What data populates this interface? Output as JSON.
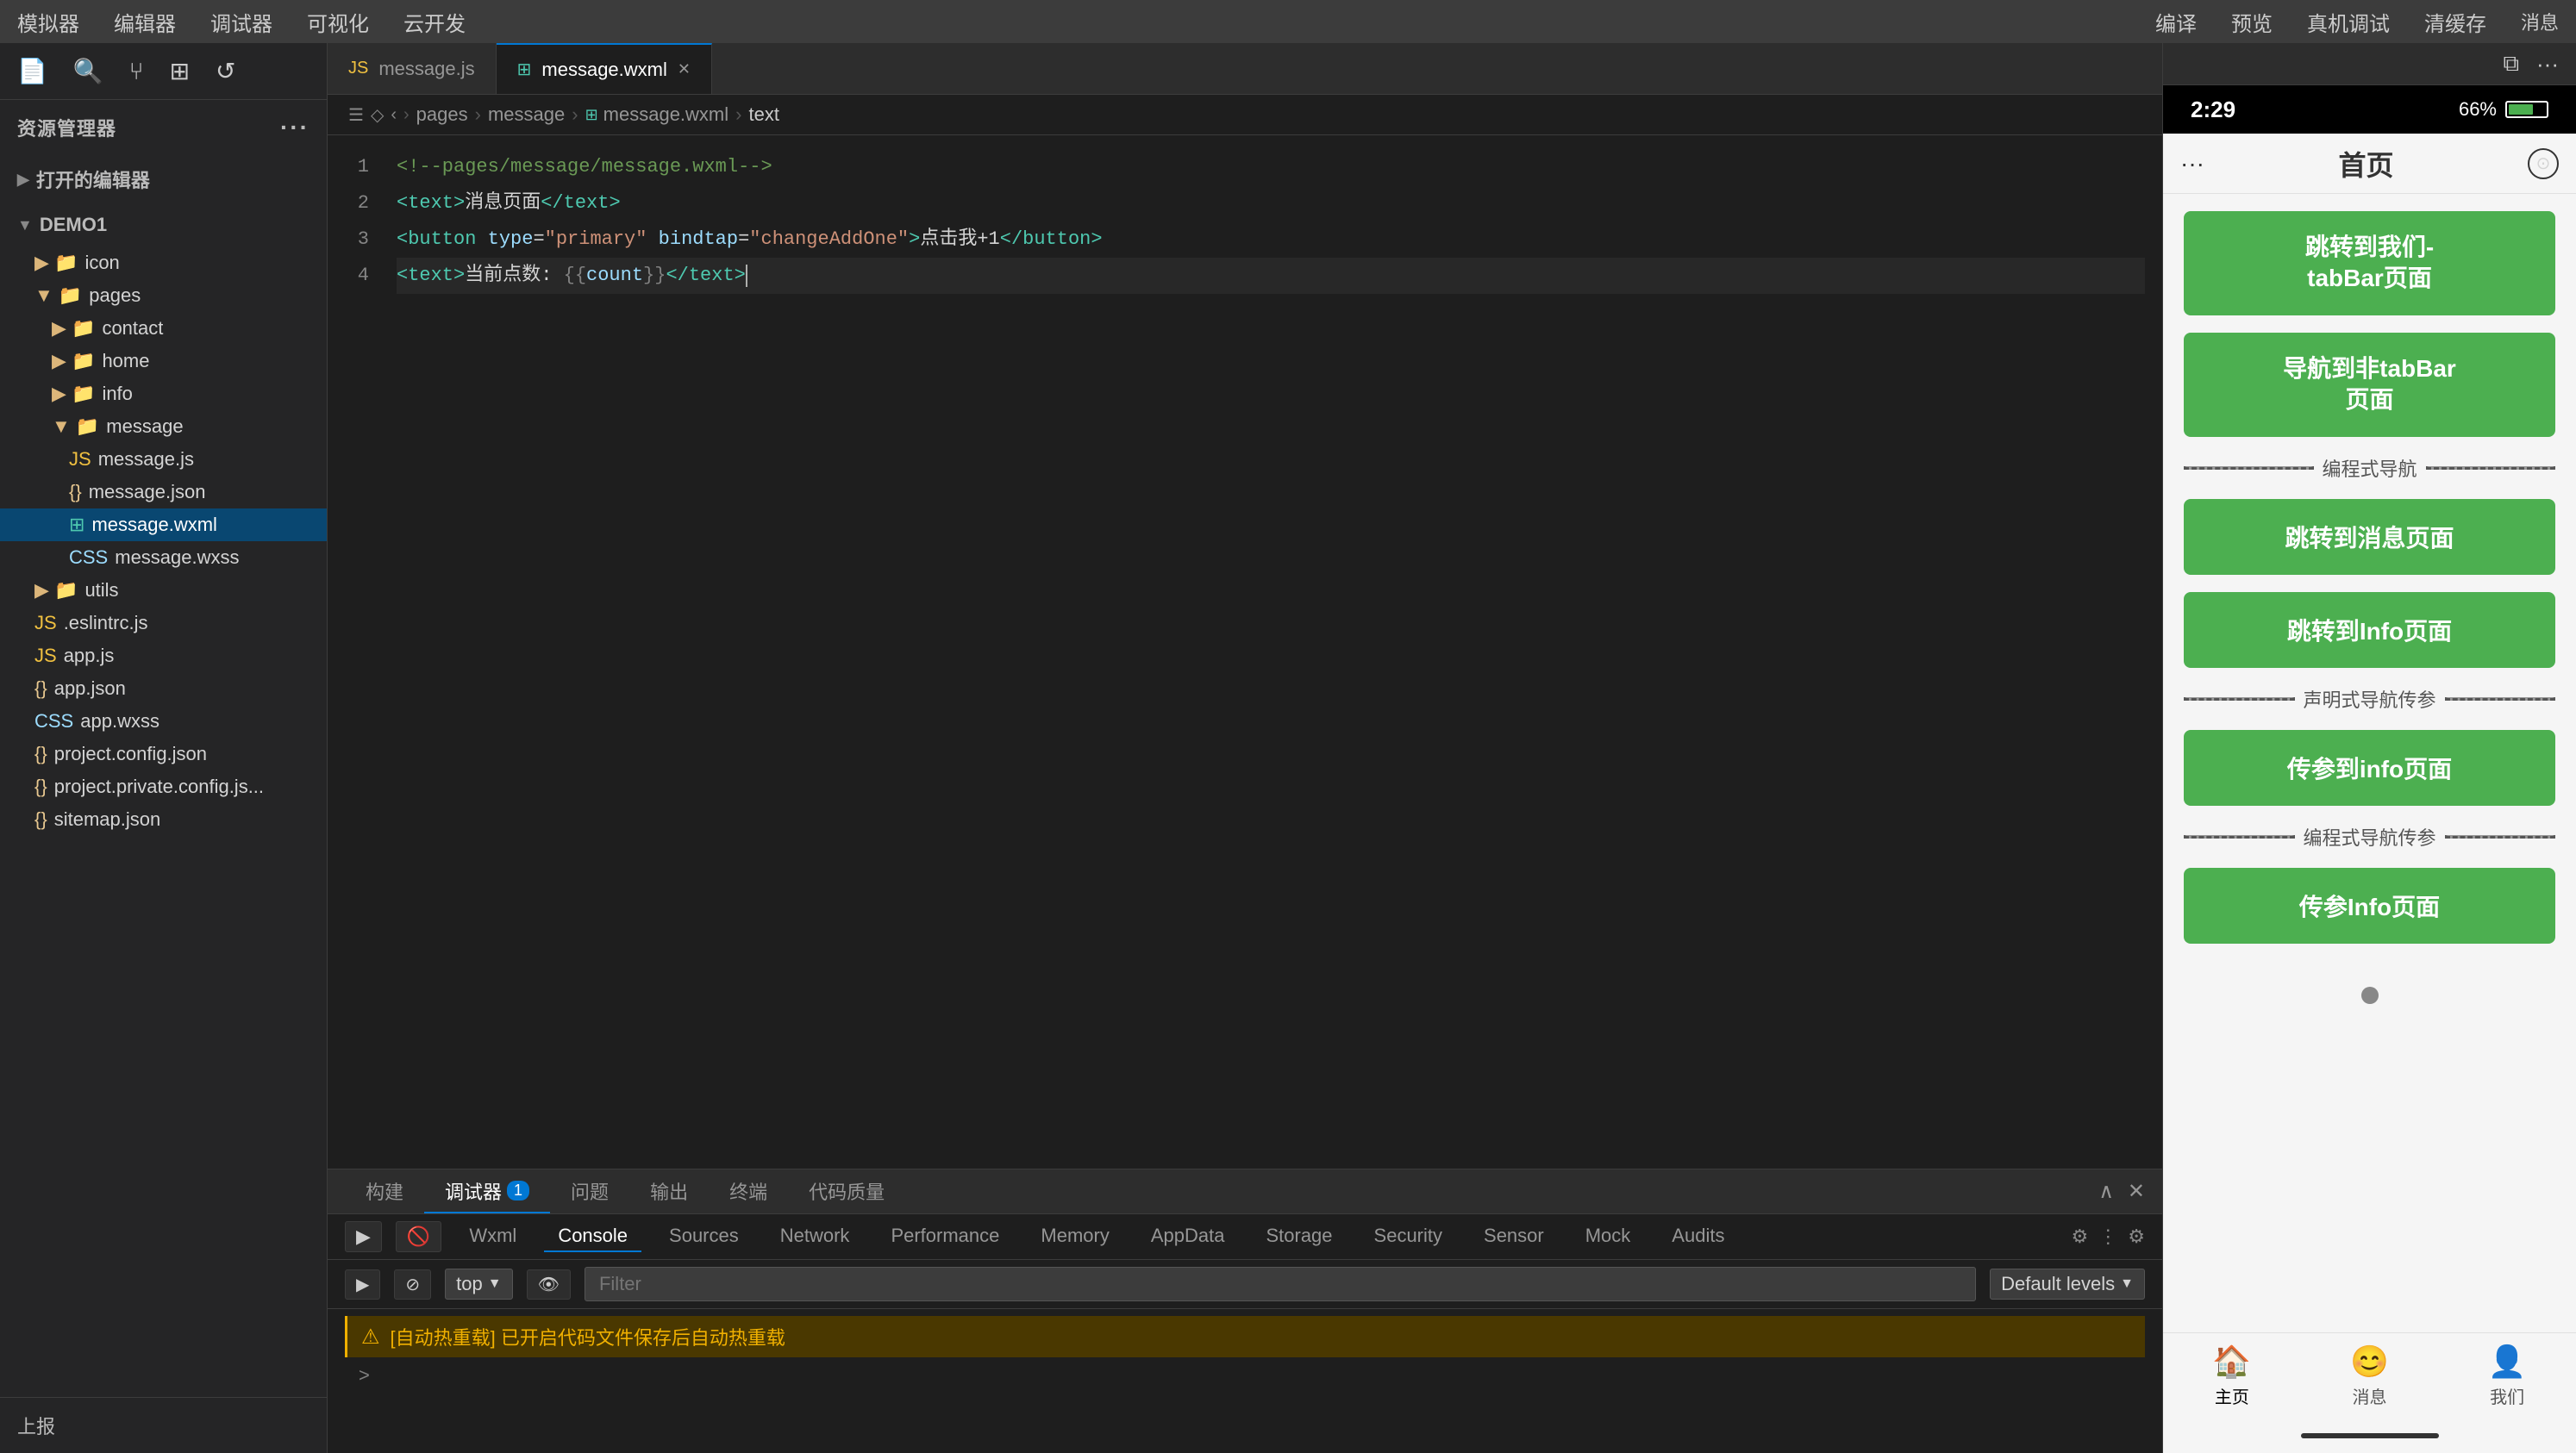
{
  "topMenu": {
    "items": [
      "模拟器",
      "编辑器",
      "调试器",
      "可视化",
      "云开发",
      "编译",
      "预览",
      "真机调试",
      "清缓存"
    ]
  },
  "sidebar": {
    "header": "资源管理器",
    "headerMore": "···",
    "openEditors": "打开的编辑器",
    "demo1": "DEMO1",
    "tree": [
      {
        "label": "icon",
        "type": "folder",
        "indent": 1
      },
      {
        "label": "pages",
        "type": "folder",
        "indent": 1
      },
      {
        "label": "contact",
        "type": "folder",
        "indent": 2
      },
      {
        "label": "home",
        "type": "folder",
        "indent": 2
      },
      {
        "label": "info",
        "type": "folder",
        "indent": 2
      },
      {
        "label": "message",
        "type": "folder",
        "indent": 2,
        "expanded": true
      },
      {
        "label": "message.js",
        "type": "js",
        "indent": 3
      },
      {
        "label": "message.json",
        "type": "json",
        "indent": 3
      },
      {
        "label": "message.wxml",
        "type": "wxml",
        "indent": 3,
        "selected": true
      },
      {
        "label": "message.wxss",
        "type": "wxss",
        "indent": 3
      },
      {
        "label": "utils",
        "type": "folder",
        "indent": 1
      },
      {
        "label": ".eslintrc.js",
        "type": "js",
        "indent": 1
      },
      {
        "label": "app.js",
        "type": "js",
        "indent": 1
      },
      {
        "label": "app.json",
        "type": "json",
        "indent": 1
      },
      {
        "label": "app.wxss",
        "type": "wxss",
        "indent": 1
      },
      {
        "label": "project.config.json",
        "type": "json",
        "indent": 1
      },
      {
        "label": "project.private.config.js...",
        "type": "json",
        "indent": 1
      },
      {
        "label": "sitemap.json",
        "type": "json",
        "indent": 1
      }
    ],
    "bottomLabel": "上报"
  },
  "tabs": [
    {
      "label": "message.js",
      "type": "js",
      "active": false
    },
    {
      "label": "message.wxml",
      "type": "wxml",
      "active": true,
      "closeable": true
    }
  ],
  "breadcrumb": {
    "items": [
      "pages",
      "message",
      "message.wxml",
      "text"
    ]
  },
  "editor": {
    "lines": [
      {
        "num": 1,
        "code": "<!--pages/message/message.wxml-->",
        "type": "comment"
      },
      {
        "num": 2,
        "code": "<text>消息页面</text>",
        "type": "code"
      },
      {
        "num": 3,
        "code": "<button type=\"primary\" bindtap=\"changeAddOne\">点击我+1</button>",
        "type": "code"
      },
      {
        "num": 4,
        "code": "<text>当前点数: {{count}}</text>",
        "type": "code",
        "cursor": true
      }
    ]
  },
  "bottomPanel": {
    "tabs": [
      "构建",
      "调试器",
      "问题",
      "输出",
      "终端",
      "代码质量"
    ],
    "activeTab": "调试器",
    "badgeTab": "调试器",
    "badgeCount": "1",
    "consoleTabs": [
      "Wxml",
      "Console",
      "Sources",
      "Network",
      "Performance",
      "Memory",
      "AppData",
      "Storage",
      "Security",
      "Sensor",
      "Mock",
      "Audits"
    ],
    "activeConsoleTab": "Console",
    "topSelect": "top",
    "filterPlaceholder": "Filter",
    "levelsLabel": "Default levels",
    "warnMessage": "[自动热重载] 已开启代码文件保存后自动热重载",
    "prompt": ">"
  },
  "simulator": {
    "time": "2:29",
    "battery": "66%",
    "appTitle": "首页",
    "buttons": [
      {
        "label": "跳转到我们-\ntabBar页面"
      },
      {
        "label": "导航到非tabBar\n页面"
      },
      {
        "label": "跳转到消息页面"
      },
      {
        "label": "跳转到Info页面"
      },
      {
        "label": "传参到info页面"
      },
      {
        "label": "传参Info页面"
      }
    ],
    "dividers": [
      {
        "label": "编程式导航"
      },
      {
        "label": "声明式导航传参"
      },
      {
        "label": "编程式导航传参"
      }
    ],
    "navItems": [
      {
        "label": "主页",
        "icon": "🏠",
        "active": true
      },
      {
        "label": "消息",
        "icon": "😊",
        "active": false
      },
      {
        "label": "我们",
        "icon": "👤",
        "active": false
      }
    ]
  },
  "rightTopBar": {
    "消息": "消息",
    "icons": [
      "split-icon",
      "more-icon"
    ]
  }
}
